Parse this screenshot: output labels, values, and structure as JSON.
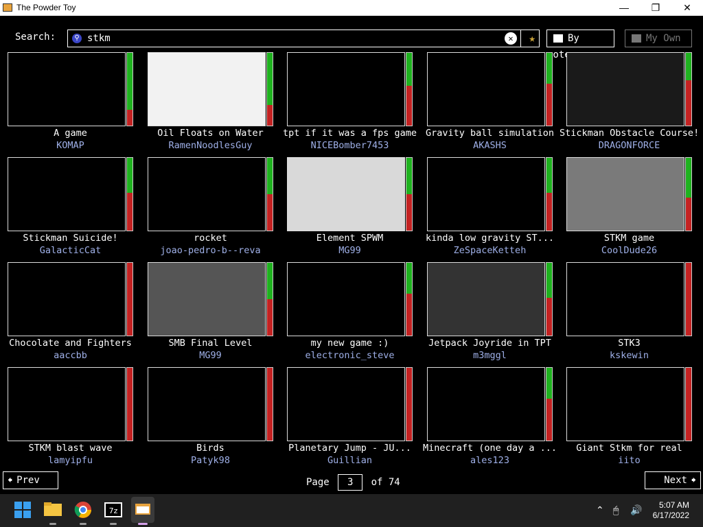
{
  "window": {
    "title": "The Powder Toy"
  },
  "search": {
    "label": "Search:",
    "query": "stkm"
  },
  "toolbar": {
    "sort_label": "By votes",
    "my_own_label": "My Own"
  },
  "saves": [
    {
      "title": "A game",
      "author": "KOMAP",
      "up": 0.78
    },
    {
      "title": "Oil Floats on Water",
      "author": "RamenNoodlesGuy",
      "up": 0.72
    },
    {
      "title": "tpt if it was a fps game",
      "author": "NICEBomber7453",
      "up": 0.45
    },
    {
      "title": "Gravity ball simulation",
      "author": "AKASHS",
      "up": 0.42
    },
    {
      "title": "Stickman Obstacle Course!",
      "author": "DRAGONFORCE",
      "up": 0.38
    },
    {
      "title": "Stickman Suicide!",
      "author": "GalacticCat",
      "up": 0.48
    },
    {
      "title": "rocket",
      "author": "joao-pedro-b--reva",
      "up": 0.5
    },
    {
      "title": "Element SPWM",
      "author": "MG99",
      "up": 0.5
    },
    {
      "title": "kinda low gravity ST...",
      "author": "ZeSpaceKetteh",
      "up": 0.48
    },
    {
      "title": "STKM game",
      "author": "CoolDude26",
      "up": 0.55
    },
    {
      "title": "Chocolate and Fighters",
      "author": "aaccbb",
      "up": 0.0
    },
    {
      "title": "SMB Final Level",
      "author": "MG99",
      "up": 0.5
    },
    {
      "title": "my new game :)",
      "author": "electronic_steve",
      "up": 0.42
    },
    {
      "title": "Jetpack Joyride in TPT",
      "author": "m3mggl",
      "up": 0.48
    },
    {
      "title": "STK3",
      "author": "kskewin",
      "up": 0.0
    },
    {
      "title": "STKM blast wave",
      "author": "lamyipfu",
      "up": 0.0
    },
    {
      "title": "Birds",
      "author": "Patyk98",
      "up": 0.0
    },
    {
      "title": "Planetary Jump - JU...",
      "author": "Guillian",
      "up": 0.0
    },
    {
      "title": "Minecraft (one day a ...",
      "author": "ales123",
      "up": 0.42
    },
    {
      "title": "Giant Stkm for real",
      "author": "iito",
      "up": 0.0
    }
  ],
  "pager": {
    "prev_label": "Prev",
    "next_label": "Next",
    "page_label": "Page",
    "current_page": "3",
    "of_label": "of 74"
  },
  "taskbar": {
    "time": "5:07 AM",
    "date": "6/17/2022"
  }
}
